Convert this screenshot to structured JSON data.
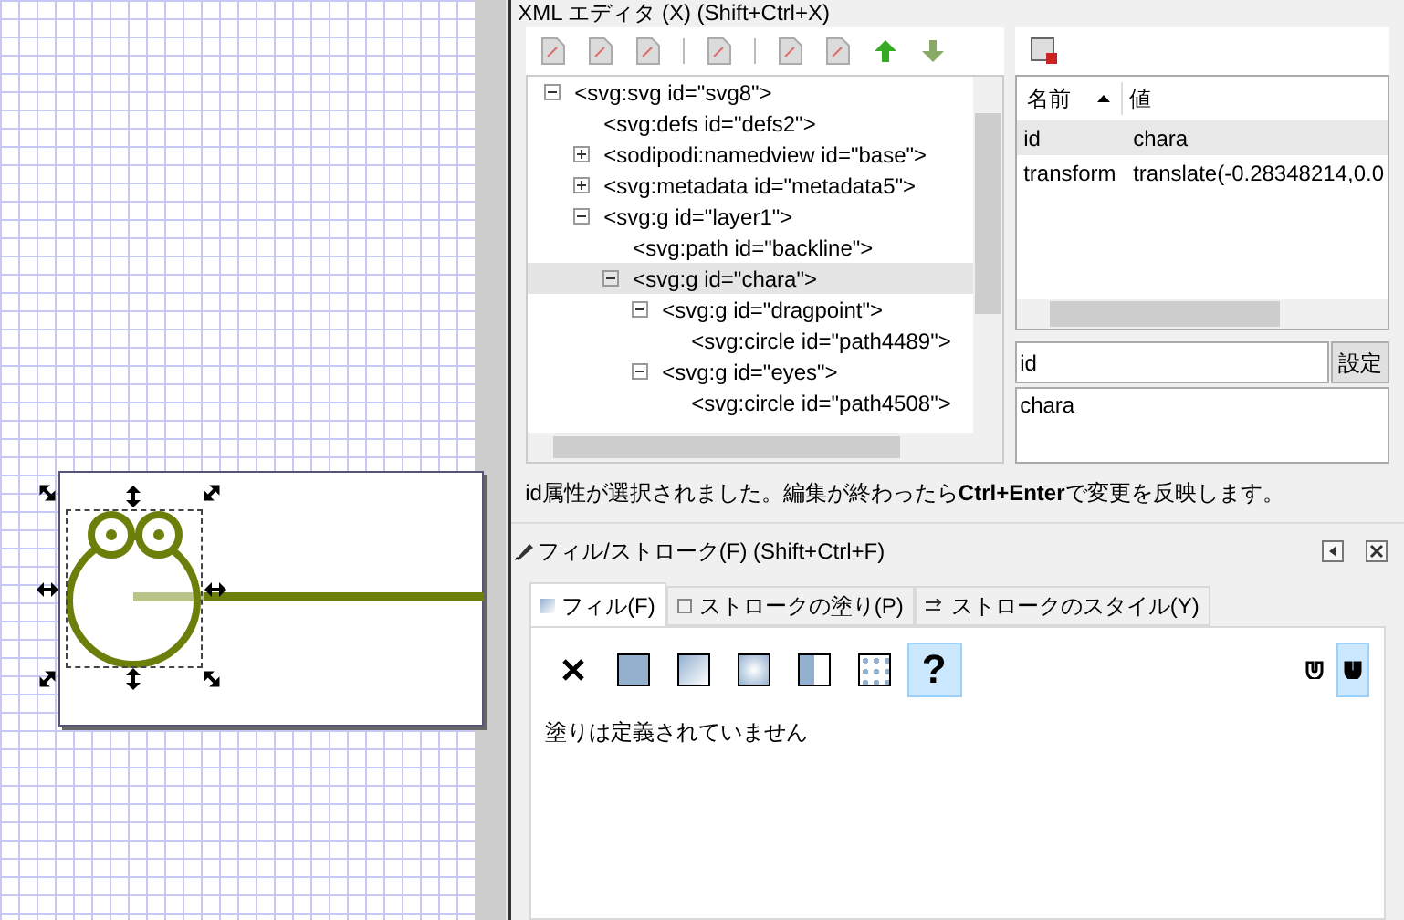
{
  "xml_editor": {
    "title": "XML エディタ (X) (Shift+Ctrl+X)",
    "tree": [
      {
        "label": "<svg:svg id=\"svg8\">",
        "expanded": true,
        "selected": false,
        "children": [
          {
            "label": "<svg:defs id=\"defs2\">",
            "selected": false
          },
          {
            "label": "<sodipodi:namedview id=\"base\">",
            "expanded": false,
            "selected": false
          },
          {
            "label": "<svg:metadata id=\"metadata5\">",
            "expanded": false,
            "selected": false
          },
          {
            "label": "<svg:g id=\"layer1\">",
            "expanded": true,
            "selected": false,
            "children": [
              {
                "label": "<svg:path id=\"backline\">",
                "selected": false
              },
              {
                "label": "<svg:g id=\"chara\">",
                "expanded": true,
                "selected": true,
                "children": [
                  {
                    "label": "<svg:g id=\"dragpoint\">",
                    "expanded": true,
                    "selected": false,
                    "children": [
                      {
                        "label": "<svg:circle id=\"path4489\">",
                        "selected": false
                      }
                    ]
                  },
                  {
                    "label": "<svg:g id=\"eyes\">",
                    "expanded": true,
                    "selected": false,
                    "children": [
                      {
                        "label": "<svg:circle id=\"path4508\">",
                        "selected": false
                      }
                    ]
                  }
                ]
              }
            ]
          }
        ]
      }
    ],
    "attributes": {
      "columns": [
        "名前",
        "値"
      ],
      "rows": [
        {
          "name": "id",
          "value": "chara",
          "selected": true
        },
        {
          "name": "transform",
          "value": "translate(-0.28348214,0.0",
          "selected": false
        }
      ]
    },
    "attr_name": "id",
    "set_button": "設定",
    "attr_value": "chara",
    "status": "id属性が選択されました。編集が終わったら**Ctrl+Enter**で変更を反映します。"
  },
  "fill_stroke": {
    "title": "フィル/ストローク(F) (Shift+Ctrl+F)",
    "tabs": [
      {
        "label": "フィル(F)",
        "kind": "fill",
        "selected": true
      },
      {
        "label": "ストロークの塗り(P)",
        "kind": "stroke",
        "selected": false
      },
      {
        "label": "ストロークのスタイル(Y)",
        "kind": "style",
        "selected": false
      }
    ],
    "paint_types": [
      {
        "kind": "none",
        "selected": false
      },
      {
        "kind": "flat",
        "selected": false
      },
      {
        "kind": "linear",
        "selected": false
      },
      {
        "kind": "radial",
        "selected": false
      },
      {
        "kind": "pattern",
        "selected": false
      },
      {
        "kind": "swatch",
        "selected": false
      },
      {
        "kind": "unset",
        "label": "?",
        "selected": true
      }
    ],
    "fill_rules": [
      {
        "kind": "evenodd",
        "selected": false
      },
      {
        "kind": "nonzero",
        "selected": true
      }
    ],
    "message": "塗りは定義されていません"
  }
}
